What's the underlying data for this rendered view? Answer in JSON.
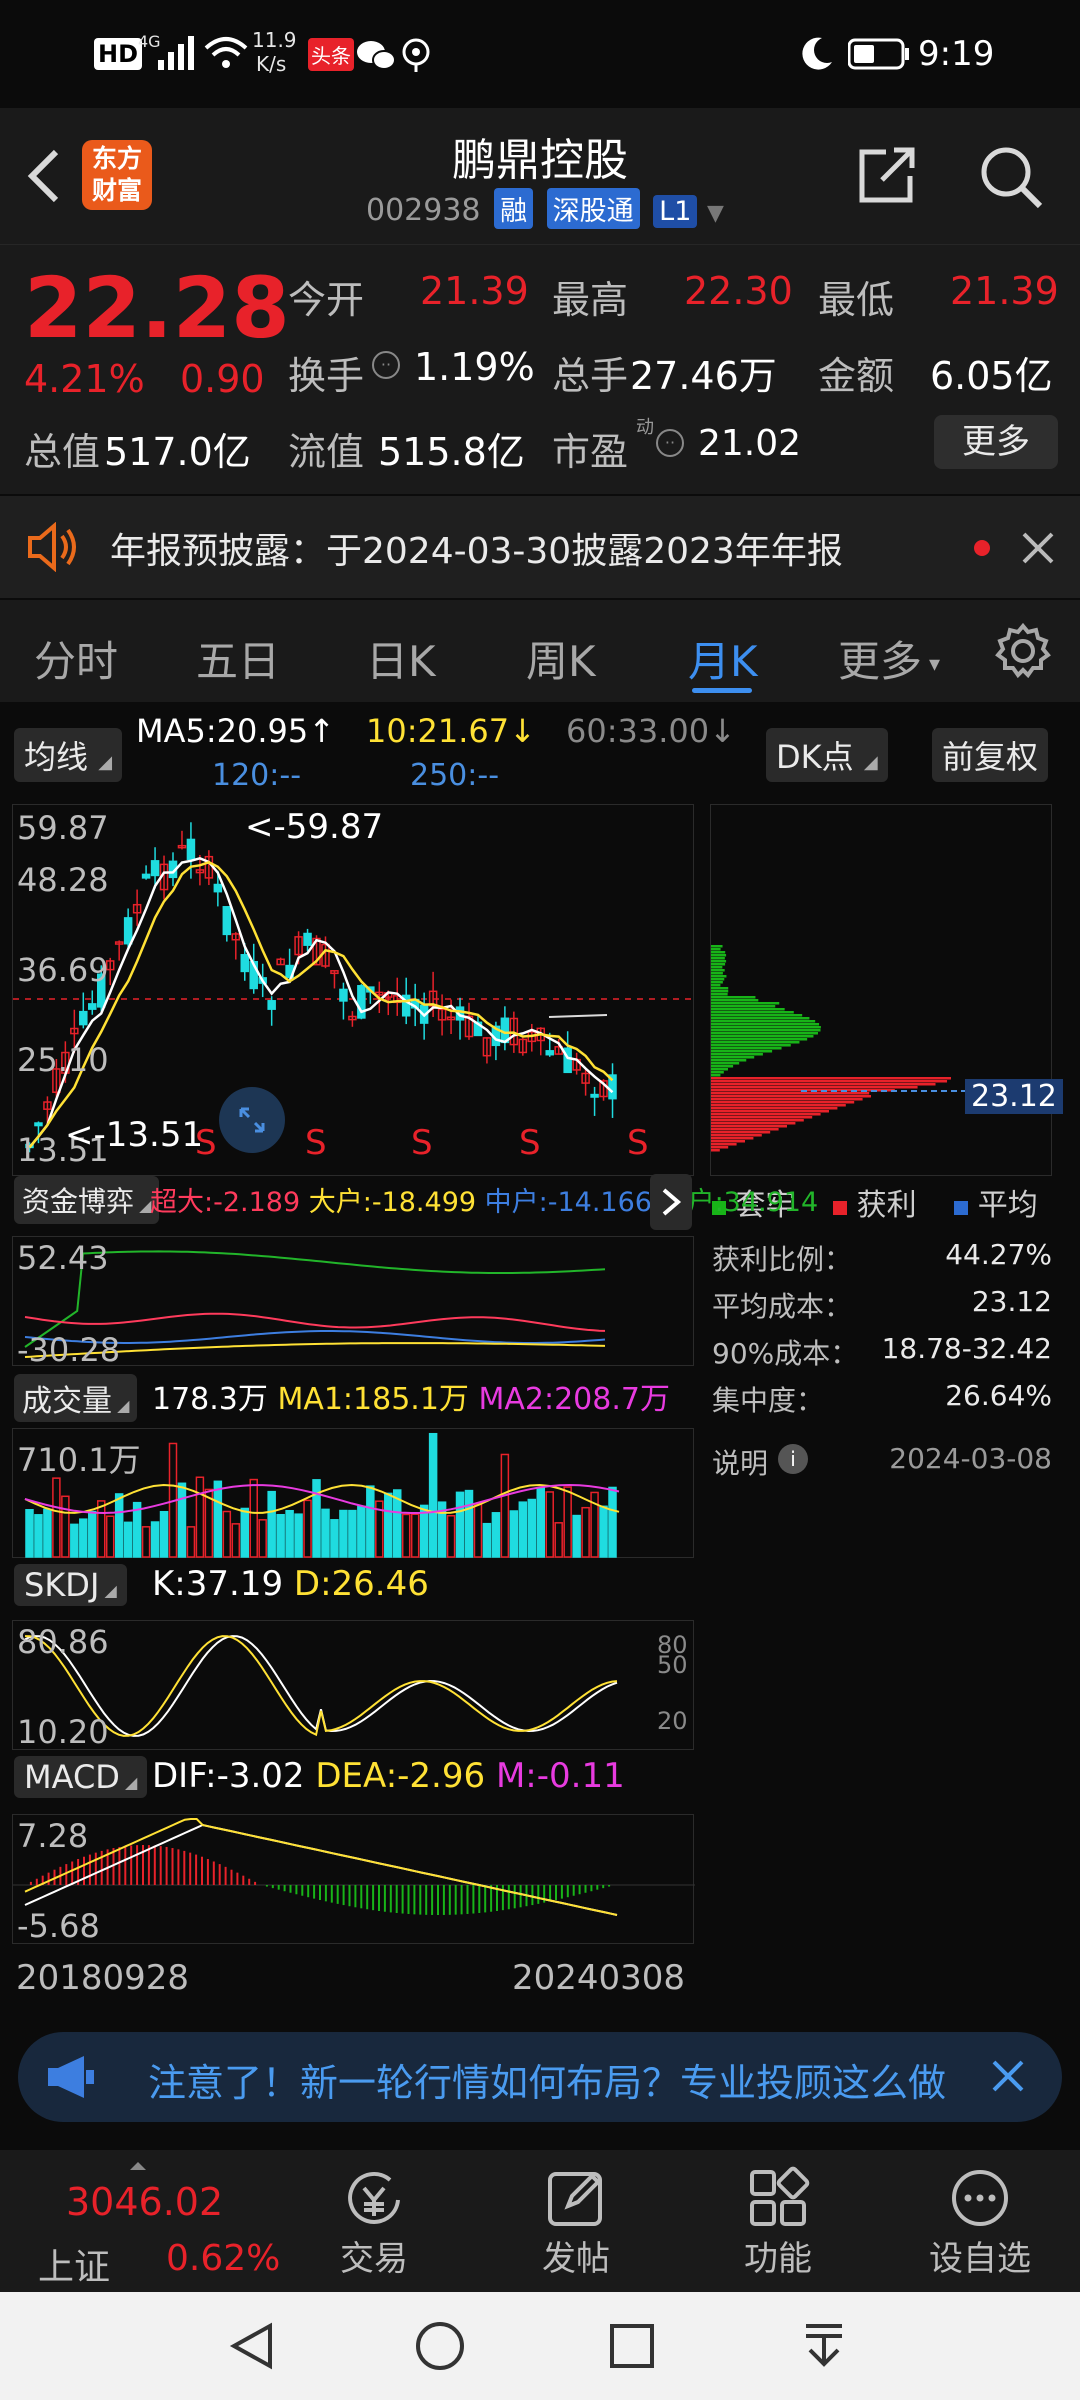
{
  "status_bar": {
    "hd": "HD",
    "net": "4G",
    "speed_num": "11.9",
    "speed_unit": "K/s",
    "toutiao": "头条",
    "time": "9:19"
  },
  "header": {
    "logo_line1": "东方",
    "logo_line2": "财富",
    "title": "鹏鼎控股",
    "code": "002938",
    "badges": [
      "融",
      "深股通",
      "L1"
    ]
  },
  "quote": {
    "price": "22.28",
    "change_pct": "4.21%",
    "change": "0.90",
    "open_label": "今开",
    "open": "21.39",
    "high_label": "最高",
    "high": "22.30",
    "low_label": "最低",
    "low": "21.39",
    "turnover_label": "换手",
    "turnover": "1.19%",
    "volume_label": "总手",
    "volume": "27.46万",
    "amount_label": "金额",
    "amount": "6.05亿",
    "mktcap_label": "总值",
    "mktcap": "517.0亿",
    "float_label": "流值",
    "float": "515.8亿",
    "pe_label": "市盈",
    "pe_sup": "动",
    "pe": "21.02",
    "more": "更多"
  },
  "notice": {
    "text": "年报预披露：于2024-03-30披露2023年年报"
  },
  "tabs": {
    "items": [
      "分时",
      "五日",
      "日K",
      "周K",
      "月K",
      "更多"
    ],
    "active": 4
  },
  "kline": {
    "ma_button": "均线",
    "ma5": "MA5:20.95",
    "ma5_arrow": "↑",
    "ma10": "10:21.67",
    "ma10_arrow": "↓",
    "ma60": "60:33.00",
    "ma60_arrow": "↓",
    "ma120": "120:--",
    "ma250": "250:--",
    "dk_button": "DK点",
    "fq_button": "前复权",
    "axis": [
      "59.87",
      "48.28",
      "36.69",
      "25.10",
      "13.51"
    ],
    "max_label": "<-59.87",
    "min_label": "<-13.51",
    "s_marks": [
      "S",
      "S",
      "S",
      "S",
      "S"
    ],
    "colors": {
      "up": "#e8222a",
      "down": "#1fdce0",
      "ma5": "#ffffff",
      "ma10": "#ffe135"
    }
  },
  "chip": {
    "price_tag": "23.12",
    "legend": [
      "套牢",
      "获利",
      "平均"
    ],
    "rows": [
      {
        "label": "获利比例：",
        "value": "44.27%"
      },
      {
        "label": "平均成本：",
        "value": "23.12"
      },
      {
        "label": "90%成本：",
        "value": "18.78-32.42"
      },
      {
        "label": "集中度：",
        "value": "26.64%"
      }
    ],
    "note_label": "说明",
    "note_date": "2024-03-08"
  },
  "fund": {
    "button": "资金博弈",
    "super": "超大:-2.189",
    "big": "大户:-18.499",
    "mid": "中户:-14.166",
    "small": "小户:34.914",
    "axis": [
      "52.43",
      "-30.28"
    ]
  },
  "volume": {
    "button": "成交量",
    "vol": "178.3万",
    "ma1": "MA1:185.1万",
    "ma2": "MA2:208.7万",
    "axis": "710.1万"
  },
  "skdj": {
    "button": "SKDJ",
    "k": "K:37.19",
    "d": "D:26.46",
    "axis": [
      "80.86",
      "10.20"
    ],
    "levels": [
      "80",
      "50",
      "20"
    ]
  },
  "macd": {
    "button": "MACD",
    "dif": "DIF:-3.02",
    "dea": "DEA:-2.96",
    "m": "M:-0.11",
    "axis": [
      "7.28",
      "-5.68"
    ]
  },
  "dates": {
    "start": "20180928",
    "end": "20240308"
  },
  "promo": {
    "text": "注意了！新一轮行情如何布局？专业投顾这么做"
  },
  "bottom_nav": {
    "index_value": "3046.02",
    "index_name": "上证",
    "index_pct": "0.62%",
    "items": [
      "交易",
      "发帖",
      "功能",
      "设自选"
    ]
  }
}
